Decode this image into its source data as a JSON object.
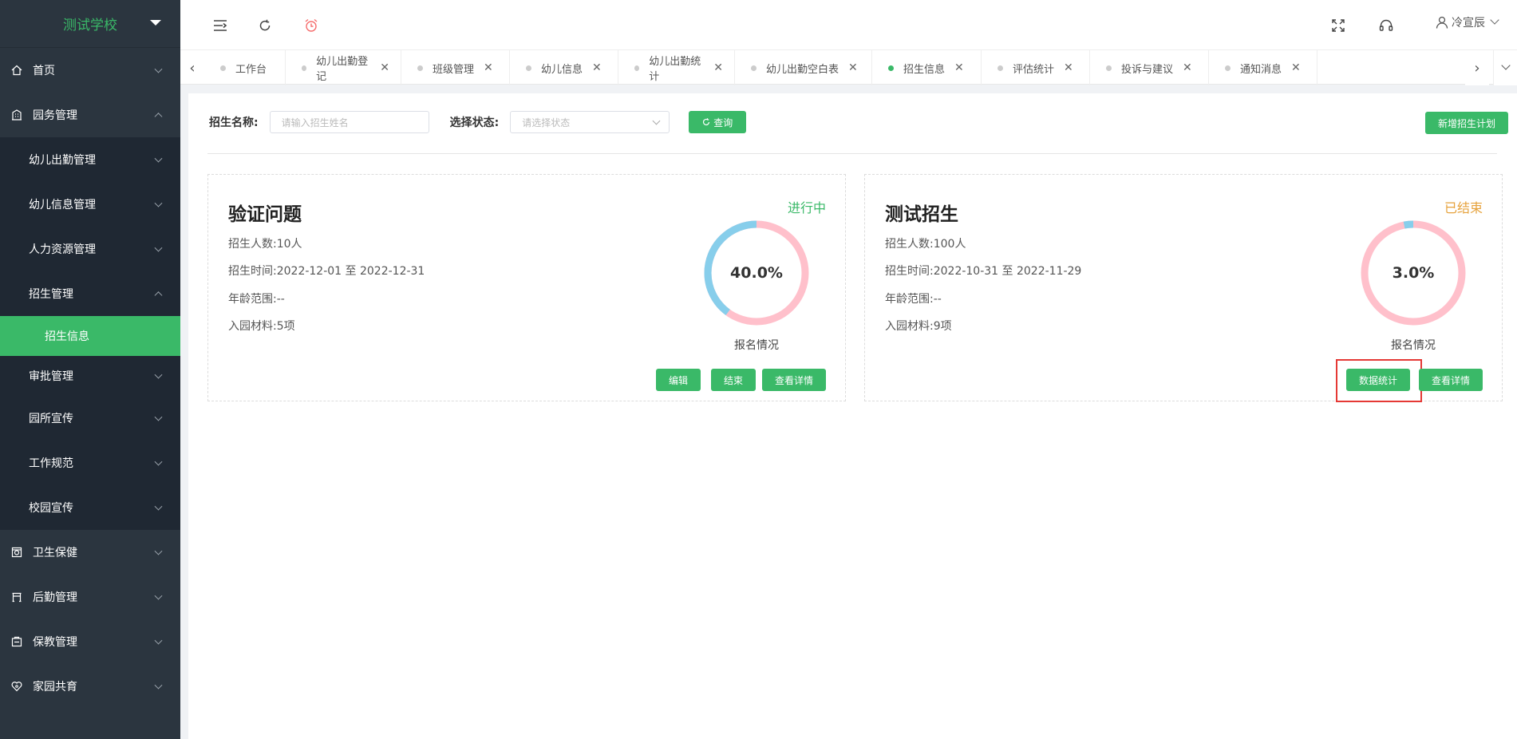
{
  "sidebar": {
    "school_name": "测试学校",
    "items": [
      {
        "label": "首页",
        "icon": "home-icon"
      },
      {
        "label": "园务管理",
        "icon": "building-icon"
      }
    ],
    "sub_items": [
      {
        "label": "幼儿出勤管理"
      },
      {
        "label": "幼儿信息管理"
      },
      {
        "label": "人力资源管理"
      },
      {
        "label": "招生管理"
      },
      {
        "label": "招生信息"
      },
      {
        "label": "审批管理"
      },
      {
        "label": "园所宣传"
      },
      {
        "label": "工作规范"
      },
      {
        "label": "校园宣传"
      }
    ],
    "bottom_items": [
      {
        "label": "卫生保健",
        "icon": "health-icon"
      },
      {
        "label": "后勤管理",
        "icon": "logistics-icon"
      },
      {
        "label": "保教管理",
        "icon": "education-icon"
      },
      {
        "label": "家园共育",
        "icon": "family-icon"
      }
    ]
  },
  "topbar": {
    "user_name": "冷宣辰"
  },
  "tabs": [
    {
      "label": "工作台",
      "closable": false
    },
    {
      "label": "幼儿出勤登记",
      "closable": true
    },
    {
      "label": "班级管理",
      "closable": true
    },
    {
      "label": "幼儿信息",
      "closable": true
    },
    {
      "label": "幼儿出勤统计",
      "closable": true
    },
    {
      "label": "幼儿出勤空白表",
      "closable": true
    },
    {
      "label": "招生信息",
      "closable": true,
      "active": true
    },
    {
      "label": "评估统计",
      "closable": true
    },
    {
      "label": "投诉与建议",
      "closable": true
    },
    {
      "label": "通知消息",
      "closable": true
    }
  ],
  "filters": {
    "name_label": "招生名称:",
    "name_placeholder": "请输入招生姓名",
    "status_label": "选择状态:",
    "status_placeholder": "请选择状态",
    "query_button": "查询",
    "add_button": "新增招生计划"
  },
  "cards": [
    {
      "title": "验证问题",
      "status": "进行中",
      "status_color": "#3ab968",
      "count": "招生人数:10人",
      "time": "招生时间:2022-12-01 至 2022-12-31",
      "age": "年龄范围:--",
      "materials": "入园材料:5项",
      "progress": 0.4,
      "progress_label": "40.0%",
      "caption": "报名情况",
      "buttons": [
        "编辑",
        "结束",
        "查看详情"
      ]
    },
    {
      "title": "测试招生",
      "status": "已结束",
      "status_color": "#e6a23c",
      "count": "招生人数:100人",
      "time": "招生时间:2022-10-31 至 2022-11-29",
      "age": "年龄范围:--",
      "materials": "入园材料:9项",
      "progress": 0.03,
      "progress_label": "3.0%",
      "caption": "报名情况",
      "buttons": [
        "数据统计",
        "查看详情"
      ]
    }
  ],
  "colors": {
    "accent": "#3ab968",
    "sidebar_bg": "#2b353f",
    "ring_fill": "#87ceeb",
    "ring_track": "#ffc0cb",
    "highlight": "#e53935"
  }
}
